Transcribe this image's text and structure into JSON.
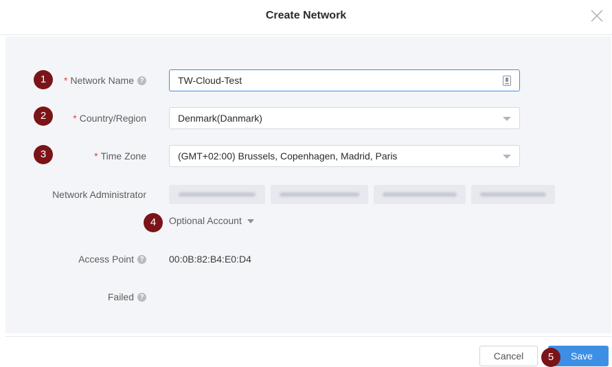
{
  "dialog": {
    "title": "Create Network"
  },
  "badges": [
    "1",
    "2",
    "3",
    "4",
    "5"
  ],
  "form": {
    "network_name": {
      "label": "Network Name",
      "value": "TW-Cloud-Test"
    },
    "country": {
      "label": "Country/Region",
      "value": "Denmark(Danmark)"
    },
    "timezone": {
      "label": "Time Zone",
      "value": "(GMT+02:00) Brussels, Copenhagen, Madrid, Paris"
    },
    "admin": {
      "label": "Network Administrator",
      "accounts_blurred": 4
    },
    "optional_account": {
      "label": "Optional Account"
    },
    "access_point": {
      "label": "Access Point",
      "value": "00:0B:82:B4:E0:D4"
    },
    "failed": {
      "label": "Failed"
    }
  },
  "required_marker": "*",
  "help_glyph": "?",
  "footer": {
    "cancel_label": "Cancel",
    "save_label": "Save"
  },
  "colors": {
    "accent": "#3d8fe6",
    "badge": "#7a1418",
    "required": "#e0403a"
  }
}
